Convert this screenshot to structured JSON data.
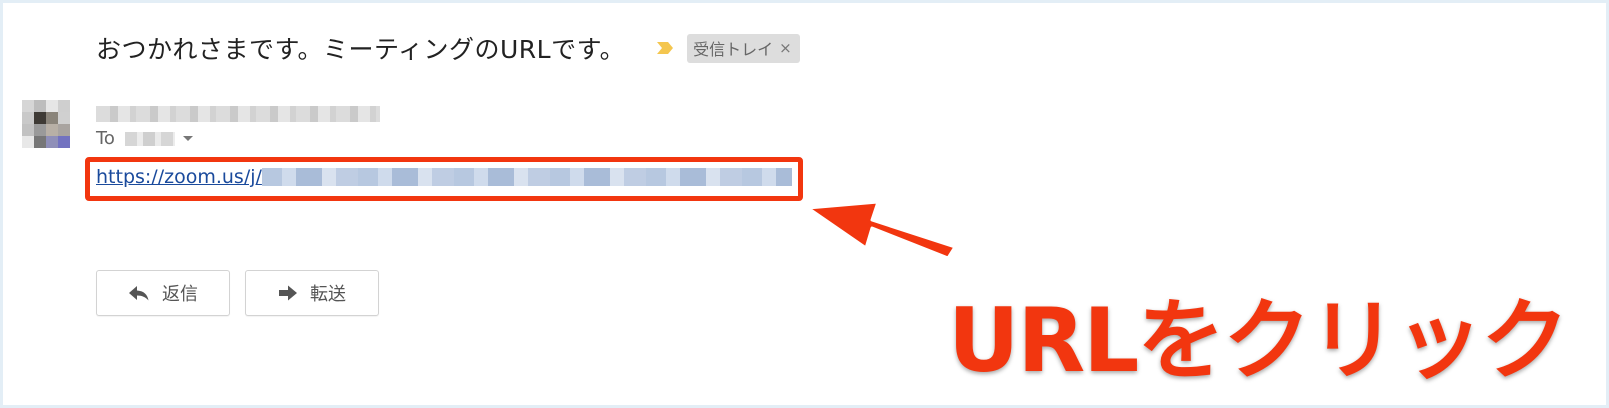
{
  "email": {
    "subject": "おつかれさまです。ミーティングのURLです。",
    "importance_icon": "importance-marker-icon",
    "label": "受信トレイ",
    "label_remove": "×",
    "sender_name": "",
    "to_prefix": "To",
    "to_recipient": "",
    "link_prefix": "https://zoom.us/j/"
  },
  "actions": {
    "reply_label": "返信",
    "forward_label": "転送"
  },
  "annotation": {
    "text": "URLをクリック"
  },
  "colors": {
    "annotation_red": "#f2360f",
    "link_blue": "#1a4a9c",
    "importance_yellow": "#f4c64f",
    "label_bg": "#dddddd"
  }
}
